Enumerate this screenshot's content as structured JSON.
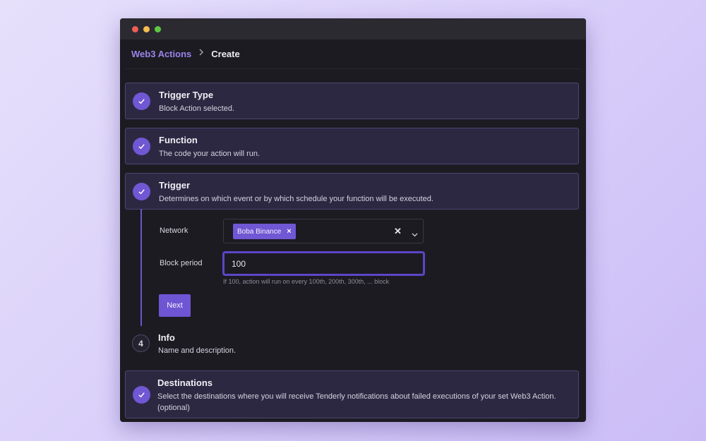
{
  "window": {
    "traffic_lights": [
      "close",
      "minimize",
      "zoom"
    ]
  },
  "breadcrumb": {
    "parent": "Web3 Actions",
    "separator": ">",
    "current": "Create"
  },
  "steps": [
    {
      "title": "Trigger Type",
      "description": "Block Action selected."
    },
    {
      "title": "Function",
      "description": "The code your action will run."
    },
    {
      "title": "Trigger",
      "description": "Determines on which event or by which schedule your function will be executed."
    }
  ],
  "trigger_form": {
    "network_label": "Network",
    "network_selected": "Boba Binance",
    "block_period_label": "Block period",
    "block_period_value": "100",
    "block_period_hint": "If 100, action will run on every 100th, 200th, 300th, ... block",
    "next_label": "Next"
  },
  "info_step": {
    "number": "4",
    "title": "Info",
    "description": "Name and description."
  },
  "destinations_step": {
    "title": "Destinations",
    "description": "Select the destinations where you will receive Tenderly notifications about failed executions of your set Web3 Action. (optional)"
  },
  "colors": {
    "accent": "#7057d3",
    "link": "#9a84ea",
    "background": "#1c1b22"
  }
}
